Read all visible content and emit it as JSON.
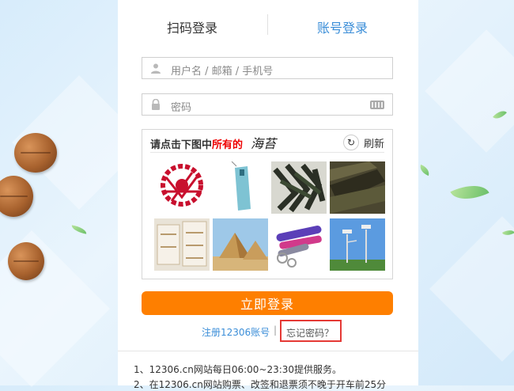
{
  "tabs": {
    "scan_label": "扫码登录",
    "account_label": "账号登录"
  },
  "username": {
    "placeholder": "用户名 / 邮箱 / 手机号"
  },
  "password": {
    "placeholder": "密码"
  },
  "captcha": {
    "prompt_prefix": "请点击下图中",
    "prompt_highlight": "所有的",
    "target_word": "海苔",
    "refresh_label": "刷新",
    "tiles": [
      "paper-cut",
      "hanging-tag",
      "seaweed",
      "seaweed-sheets",
      "cotton-swabs",
      "pyramids",
      "keychains",
      "solar-street-lights"
    ]
  },
  "login_button": "立即登录",
  "register_link": "注册12306账号",
  "separator": "|",
  "forgot_link": "忘记密码？",
  "notices": [
    "1、12306.cn网站每日06:00~23:30提供服务。",
    "2、在12306.cn网站购票、改签和退票须不晚于开车前25分"
  ],
  "colors": {
    "accent": "#3b8ed8",
    "login_button": "#fe7f00",
    "highlight_border": "#e53935"
  }
}
